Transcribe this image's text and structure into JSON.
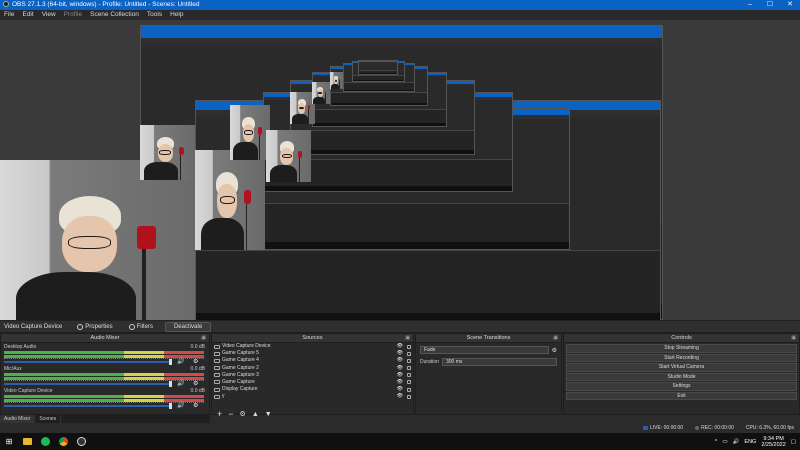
{
  "window": {
    "title": "OBS 27.1.3 (64-bit, windows) - Profile: Untitled - Scenes: Untitled"
  },
  "menu": [
    "File",
    "Edit",
    "View",
    "Profile",
    "Scene Collection",
    "Tools",
    "Help"
  ],
  "source_bar": {
    "selected": "Video Capture Device",
    "properties": "Properties",
    "filters": "Filters",
    "deactivate": "Deactivate"
  },
  "mixer": {
    "title": "Audio Mixer",
    "channels": [
      {
        "name": "Desktop Audio",
        "db": "0.0 dB"
      },
      {
        "name": "Mic/Aux",
        "db": "0.0 dB"
      },
      {
        "name": "Video Capture Device",
        "db": "0.0 dB"
      }
    ],
    "tabs": [
      "Audio Mixer",
      "Scenes"
    ]
  },
  "sources": {
    "title": "Sources",
    "items": [
      "Video Capture Device",
      "Game Capture 5",
      "Game Capture 4",
      "Game Capture 2",
      "Game Capture 3",
      "Game Capture",
      "Display Capture",
      "y"
    ]
  },
  "transitions": {
    "title": "Scene Transitions",
    "type": "Fade",
    "duration_label": "Duration",
    "duration": "300 ms"
  },
  "controls": {
    "title": "Controls",
    "buttons": [
      "Stop Streaming",
      "Start Recording",
      "Start Virtual Camera",
      "Studio Mode",
      "Settings",
      "Exit"
    ]
  },
  "status": {
    "live": "LIVE: 00:00:00",
    "rec": "REC: 00:00:00",
    "cpu": "CPU: 6.3%, 60.00 fps"
  },
  "taskbar": {
    "lang": "ENG",
    "time": "9:34 PM",
    "date": "2/25/2022"
  },
  "colors": {
    "titlebar": "#0a62c4",
    "bg": "#2b2b2b",
    "accent": "#2b5fab"
  }
}
